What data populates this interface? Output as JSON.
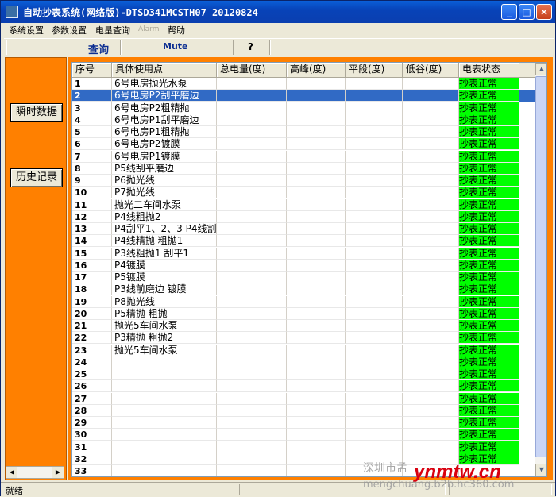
{
  "window": {
    "title": "自动抄表系统(网络版)-DTSD341MCSTH07 20120824",
    "minimize_label": "_",
    "maximize_label": "□",
    "close_label": "×"
  },
  "menu": {
    "items": [
      "系统设置",
      "参数设置",
      "电量查询",
      "Alarm",
      "帮助"
    ]
  },
  "toolbar": {
    "query_label": "查询",
    "mute_label": "Mute",
    "help_label": "?"
  },
  "sidebar": {
    "realtime_label": "瞬时数据",
    "history_label": "历史记录"
  },
  "table": {
    "columns": [
      "序号",
      "具体使用点",
      "总电量(度)",
      "高峰(度)",
      "平段(度)",
      "低谷(度)",
      "电表状态"
    ],
    "selected_row": 2,
    "rows": [
      {
        "seq": "1",
        "point": "6号电房抛光水泵",
        "status": "抄表正常"
      },
      {
        "seq": "2",
        "point": "6号电房P2刮平磨边",
        "status": "抄表正常"
      },
      {
        "seq": "3",
        "point": "6号电房P2粗精抛",
        "status": "抄表正常"
      },
      {
        "seq": "4",
        "point": "6号电房P1刮平磨边",
        "status": "抄表正常"
      },
      {
        "seq": "5",
        "point": "6号电房P1粗精抛",
        "status": "抄表正常"
      },
      {
        "seq": "6",
        "point": "6号电房P2镀膜",
        "status": "抄表正常"
      },
      {
        "seq": "7",
        "point": "6号电房P1镀膜",
        "status": "抄表正常"
      },
      {
        "seq": "8",
        "point": "P5线刮平磨边",
        "status": "抄表正常"
      },
      {
        "seq": "9",
        "point": "P6抛光线",
        "status": "抄表正常"
      },
      {
        "seq": "10",
        "point": "P7抛光线",
        "status": "抄表正常"
      },
      {
        "seq": "11",
        "point": "抛光二车间水泵",
        "status": "抄表正常"
      },
      {
        "seq": "12",
        "point": "P4线粗抛2",
        "status": "抄表正常"
      },
      {
        "seq": "13",
        "point": "P4刮平1、2、3 P4线割",
        "status": "抄表正常"
      },
      {
        "seq": "14",
        "point": "P4线精抛 粗抛1",
        "status": "抄表正常"
      },
      {
        "seq": "15",
        "point": "P3线粗抛1 刮平1",
        "status": "抄表正常"
      },
      {
        "seq": "16",
        "point": "P4镀膜",
        "status": "抄表正常"
      },
      {
        "seq": "17",
        "point": "P5镀膜",
        "status": "抄表正常"
      },
      {
        "seq": "18",
        "point": "P3线前磨边 镀膜",
        "status": "抄表正常"
      },
      {
        "seq": "19",
        "point": "P8抛光线",
        "status": "抄表正常"
      },
      {
        "seq": "20",
        "point": "P5精抛 粗抛",
        "status": "抄表正常"
      },
      {
        "seq": "21",
        "point": "抛光5车间水泵",
        "status": "抄表正常"
      },
      {
        "seq": "22",
        "point": " P3精抛 粗抛2",
        "status": "抄表正常"
      },
      {
        "seq": "23",
        "point": "抛光5车间水泵",
        "status": "抄表正常"
      },
      {
        "seq": "24",
        "point": "",
        "status": "抄表正常"
      },
      {
        "seq": "25",
        "point": "",
        "status": "抄表正常"
      },
      {
        "seq": "26",
        "point": "",
        "status": "抄表正常"
      },
      {
        "seq": "27",
        "point": "",
        "status": "抄表正常"
      },
      {
        "seq": "28",
        "point": "",
        "status": "抄表正常"
      },
      {
        "seq": "29",
        "point": "",
        "status": "抄表正常"
      },
      {
        "seq": "30",
        "point": "",
        "status": "抄表正常"
      },
      {
        "seq": "31",
        "point": "",
        "status": "抄表正常"
      },
      {
        "seq": "32",
        "point": "",
        "status": "抄表正常"
      },
      {
        "seq": "33",
        "point": "",
        "status": ""
      }
    ]
  },
  "statusbar": {
    "text": "就绪"
  },
  "watermark": {
    "line1": "深圳市孟",
    "line2": "mengchuang.b2b.hc360.com",
    "brand": "ynmtw.cn"
  },
  "colors": {
    "panel": "#ff8000",
    "selection": "#316ac5",
    "status_ok": "#00ff00",
    "title_bar": "#0a5fd8"
  }
}
